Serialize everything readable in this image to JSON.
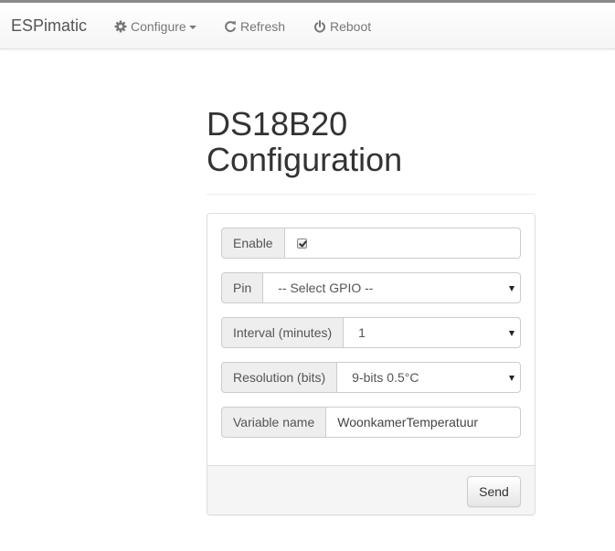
{
  "navbar": {
    "brand": "ESPimatic",
    "items": [
      {
        "label": "Configure",
        "icon": "gear-icon"
      },
      {
        "label": "Refresh",
        "icon": "refresh-icon"
      },
      {
        "label": "Reboot",
        "icon": "power-icon"
      }
    ]
  },
  "page": {
    "title": "DS18B20 Configuration"
  },
  "form": {
    "enable": {
      "label": "Enable",
      "checked": true
    },
    "pin": {
      "label": "Pin",
      "value": "-- Select GPIO --"
    },
    "interval": {
      "label": "Interval (minutes)",
      "value": "1"
    },
    "resolution": {
      "label": "Resolution (bits)",
      "value": "9-bits 0.5°C"
    },
    "variable_name": {
      "label": "Variable name",
      "value": "WoonkamerTemperatuur"
    },
    "send_label": "Send"
  }
}
